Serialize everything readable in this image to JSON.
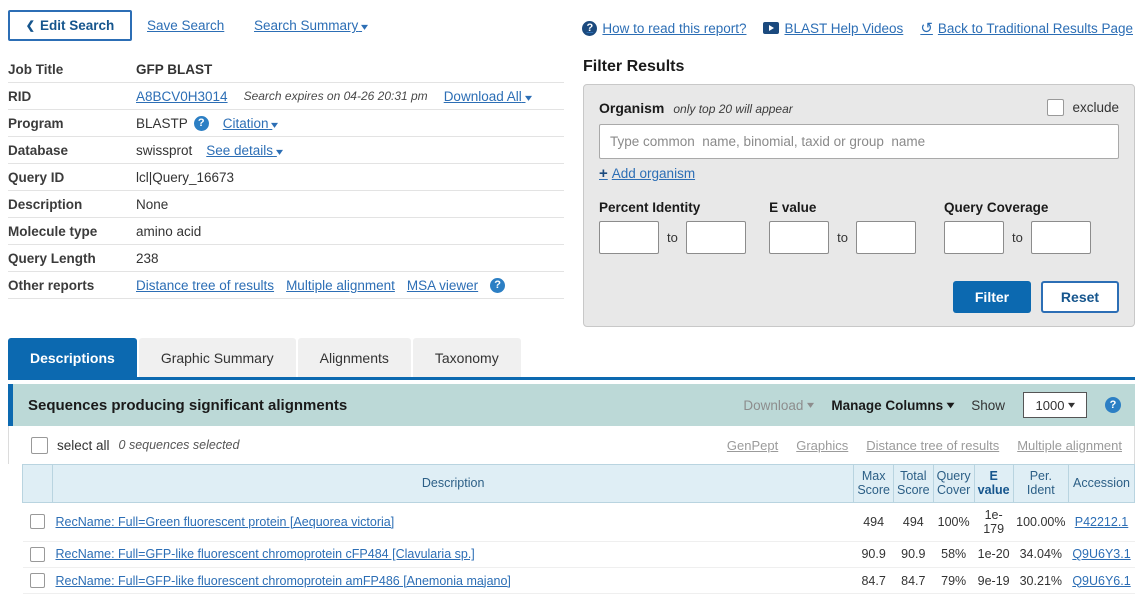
{
  "topbar": {
    "edit_search": "Edit Search",
    "save_search": "Save Search",
    "search_summary": "Search Summary",
    "how_to_read": "How to read this report?",
    "help_videos": "BLAST Help Videos",
    "back_traditional": "Back to Traditional Results Page"
  },
  "info": {
    "rows": [
      {
        "label": "Job Title",
        "value": "GFP BLAST"
      },
      {
        "label": "RID",
        "value": "A8BCV0H3014",
        "expires": "Search expires on 04-26 20:31 pm",
        "download_all": "Download All"
      },
      {
        "label": "Program",
        "value": "BLASTP",
        "citation": "Citation"
      },
      {
        "label": "Database",
        "value": "swissprot",
        "see_details": "See details"
      },
      {
        "label": "Query ID",
        "value": "lcl|Query_16673"
      },
      {
        "label": "Description",
        "value": "None"
      },
      {
        "label": "Molecule type",
        "value": "amino acid"
      },
      {
        "label": "Query Length",
        "value": "238"
      },
      {
        "label": "Other reports",
        "links": [
          "Distance tree of results",
          "Multiple alignment",
          "MSA viewer"
        ]
      }
    ]
  },
  "filter": {
    "title": "Filter Results",
    "organism_label": "Organism",
    "organism_hint": "only top 20 will appear",
    "exclude_label": "exclude",
    "organism_placeholder": "Type common  name, binomial, taxid or group  name",
    "organism_value": "",
    "add_organism": "Add organism",
    "groups": [
      {
        "label": "Percent Identity",
        "from": "",
        "to": "",
        "to_label": "to"
      },
      {
        "label": "E value",
        "from": "",
        "to": "",
        "to_label": "to"
      },
      {
        "label": "Query Coverage",
        "from": "",
        "to": "",
        "to_label": "to"
      }
    ],
    "filter_button": "Filter",
    "reset_button": "Reset"
  },
  "tabs": [
    {
      "label": "Descriptions",
      "active": true
    },
    {
      "label": "Graphic Summary",
      "active": false
    },
    {
      "label": "Alignments",
      "active": false
    },
    {
      "label": "Taxonomy",
      "active": false
    }
  ],
  "results_header": {
    "title": "Sequences producing significant alignments",
    "download": "Download",
    "manage_columns": "Manage Columns",
    "show_label": "Show",
    "show_value": "1000"
  },
  "select_row": {
    "select_all": "select all",
    "count_text": "0 sequences selected",
    "links": [
      "GenPept",
      "Graphics",
      "Distance tree of results",
      "Multiple alignment"
    ]
  },
  "table": {
    "headers": {
      "description": "Description",
      "max_score": "Max Score",
      "total_score": "Total Score",
      "query_cover": "Query Cover",
      "e_value": "E value",
      "per_ident": "Per. Ident",
      "accession": "Accession"
    },
    "rows": [
      {
        "description": "RecName: Full=Green fluorescent protein [Aequorea victoria]",
        "max_score": "494",
        "total_score": "494",
        "query_cover": "100%",
        "e_value": "1e-179",
        "per_ident": "100.00%",
        "accession": "P42212.1"
      },
      {
        "description": "RecName: Full=GFP-like fluorescent chromoprotein cFP484 [Clavularia sp.]",
        "max_score": "90.9",
        "total_score": "90.9",
        "query_cover": "58%",
        "e_value": "1e-20",
        "per_ident": "34.04%",
        "accession": "Q9U6Y3.1"
      },
      {
        "description": "RecName: Full=GFP-like fluorescent chromoprotein amFP486 [Anemonia majano]",
        "max_score": "84.7",
        "total_score": "84.7",
        "query_cover": "79%",
        "e_value": "9e-19",
        "per_ident": "30.21%",
        "accession": "Q9U6Y6.1"
      }
    ]
  },
  "colors": {
    "accent_blue": "#0c69b0",
    "link_blue": "#2c6eb5",
    "header_teal": "#bcd9d7",
    "table_header": "#dfeef5"
  }
}
